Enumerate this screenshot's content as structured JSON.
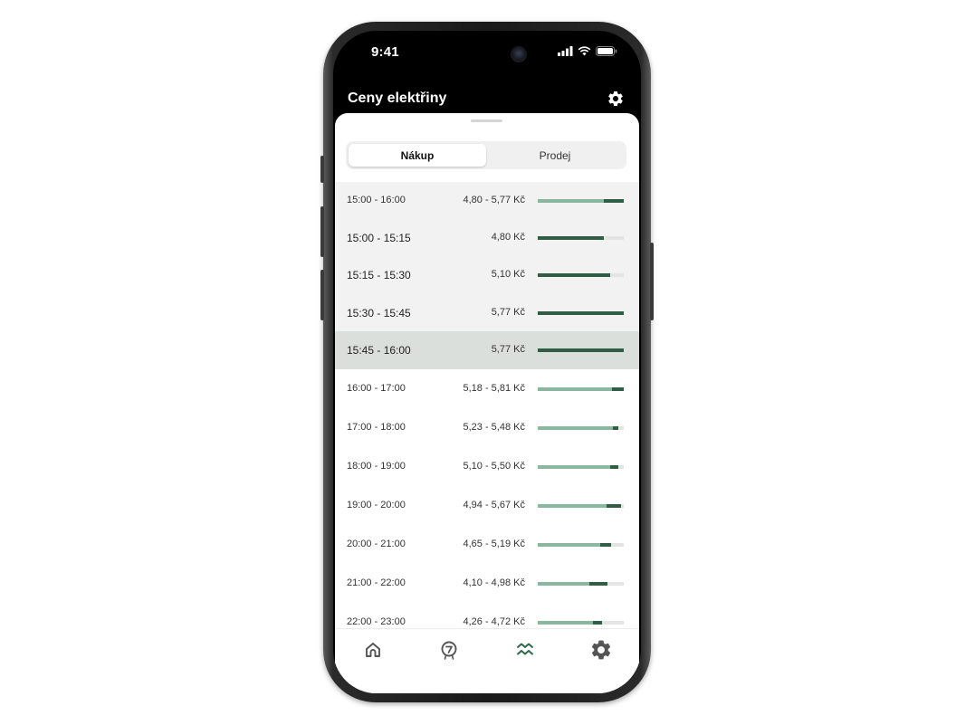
{
  "status_bar": {
    "time": "9:41"
  },
  "header": {
    "title": "Ceny elektřiny",
    "settings_icon": "gear-icon"
  },
  "tabs": {
    "active": "Nákup",
    "inactive": "Prodej"
  },
  "colors": {
    "bar_light": "#8ab89e",
    "bar_dark": "#2f5e45",
    "bar_track": "#e4e4e4",
    "selected_row": "#dadfdc",
    "group_bg": "#f2f2f2"
  },
  "rows": [
    {
      "time": "15:00 - 16:00",
      "price": "4,80 - 5,77 Kč",
      "low": 0.77,
      "high": 1.0,
      "kind": "group"
    },
    {
      "time": "15:00 - 15:15",
      "price": "4,80 Kč",
      "low": 0.0,
      "high": 0.77,
      "kind": "sub"
    },
    {
      "time": "15:15 - 15:30",
      "price": "5,10 Kč",
      "low": 0.0,
      "high": 0.84,
      "kind": "sub"
    },
    {
      "time": "15:30 - 15:45",
      "price": "5,77 Kč",
      "low": 0.0,
      "high": 1.0,
      "kind": "sub"
    },
    {
      "time": "15:45 - 16:00",
      "price": "5,77 Kč",
      "low": 0.0,
      "high": 1.0,
      "kind": "selected"
    },
    {
      "time": "16:00 - 17:00",
      "price": "5,18 - 5,81 Kč",
      "low": 0.86,
      "high": 1.0,
      "kind": "normal"
    },
    {
      "time": "17:00 - 18:00",
      "price": "5,23 - 5,48 Kč",
      "low": 0.87,
      "high": 0.93,
      "kind": "normal"
    },
    {
      "time": "18:00 - 19:00",
      "price": "5,10 - 5,50 Kč",
      "low": 0.84,
      "high": 0.93,
      "kind": "normal"
    },
    {
      "time": "19:00 - 20:00",
      "price": "4,94 - 5,67 Kč",
      "low": 0.8,
      "high": 0.97,
      "kind": "normal"
    },
    {
      "time": "20:00 - 21:00",
      "price": "4,65 - 5,19 Kč",
      "low": 0.73,
      "high": 0.86,
      "kind": "normal"
    },
    {
      "time": "21:00 - 22:00",
      "price": "4,10 - 4,98 Kč",
      "low": 0.6,
      "high": 0.81,
      "kind": "normal"
    },
    {
      "time": "22:00 - 23:00",
      "price": "4,26 - 4,72 Kč",
      "low": 0.64,
      "high": 0.75,
      "kind": "normal"
    }
  ],
  "tabbar": [
    {
      "name": "home",
      "icon": "home-icon"
    },
    {
      "name": "tariff",
      "icon": "tariff-badge-icon"
    },
    {
      "name": "prices",
      "icon": "price-waves-icon",
      "active": true
    },
    {
      "name": "settings",
      "icon": "gear-icon"
    }
  ]
}
